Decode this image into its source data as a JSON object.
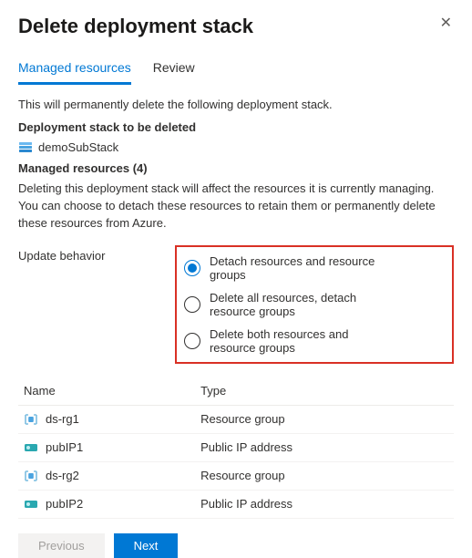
{
  "header": {
    "title": "Delete deployment stack"
  },
  "tabs": [
    {
      "label": "Managed resources",
      "active": true
    },
    {
      "label": "Review",
      "active": false
    }
  ],
  "intro": "This will permanently delete the following deployment stack.",
  "stack_section_label": "Deployment stack to be deleted",
  "stack": {
    "name": "demoSubStack",
    "icon": "stack-icon"
  },
  "managed_label": "Managed resources (4)",
  "managed_desc": "Deleting this deployment stack will affect the resources it is currently managing. You can choose to detach these resources to retain them or permanently delete these resources from Azure.",
  "behavior": {
    "label": "Update behavior",
    "options": [
      {
        "label": "Detach resources and resource groups",
        "selected": true
      },
      {
        "label": "Delete all resources, detach resource groups",
        "selected": false
      },
      {
        "label": "Delete both resources and resource groups",
        "selected": false
      }
    ]
  },
  "table": {
    "headers": {
      "name": "Name",
      "type": "Type"
    },
    "rows": [
      {
        "name": "ds-rg1",
        "type": "Resource group",
        "icon": "resource-group-icon"
      },
      {
        "name": "pubIP1",
        "type": "Public IP address",
        "icon": "public-ip-icon"
      },
      {
        "name": "ds-rg2",
        "type": "Resource group",
        "icon": "resource-group-icon"
      },
      {
        "name": "pubIP2",
        "type": "Public IP address",
        "icon": "public-ip-icon"
      }
    ]
  },
  "footer": {
    "previous": "Previous",
    "next": "Next"
  }
}
